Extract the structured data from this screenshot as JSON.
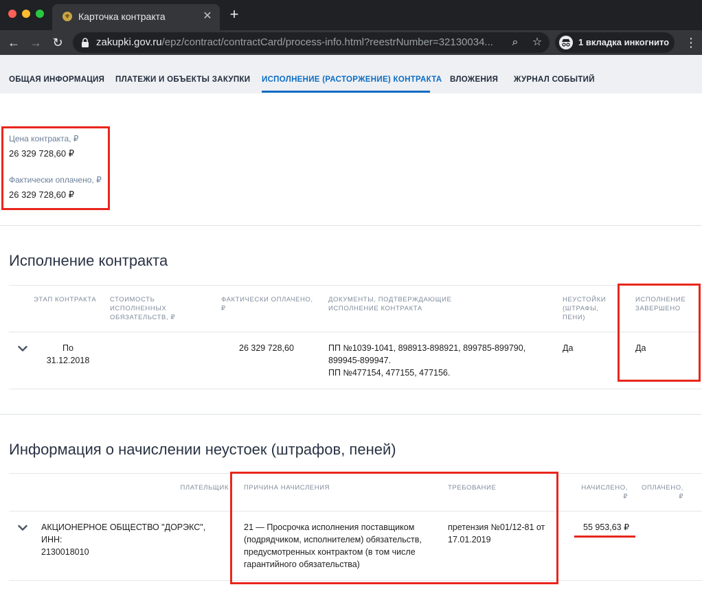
{
  "browser": {
    "tab_title": "Карточка контракта",
    "url_host": "zakupki.gov.ru",
    "url_path": "/epz/contract/contractCard/process-info.html?reestrNumber=32130034...",
    "incognito_label": "1 вкладка инкогнито"
  },
  "page_tabs": [
    {
      "label": "ОБЩАЯ ИНФОРМАЦИЯ"
    },
    {
      "label": "ПЛАТЕЖИ И ОБЪЕКТЫ ЗАКУПКИ"
    },
    {
      "label": "ИСПОЛНЕНИЕ (РАСТОРЖЕНИЕ) КОНТРАКТА"
    },
    {
      "label": "ВЛОЖЕНИЯ"
    },
    {
      "label": "ЖУРНАЛ СОБЫТИЙ"
    }
  ],
  "active_tab": "ИСПОЛНЕНИЕ (РАСТОРЖЕНИЕ) КОНТРАКТА",
  "summary": {
    "price_label": "Цена контракта, ₽",
    "price_value": "26 329 728,60 ₽",
    "paid_label": "Фактически оплачено, ₽",
    "paid_value": "26 329 728,60 ₽"
  },
  "execution": {
    "title": "Исполнение контракта",
    "headers": {
      "stage": "ЭТАП КОНТРАКТА",
      "cost": "СТОИМОСТЬ ИСПОЛНЕННЫХ ОБЯЗАТЕЛЬСТВ, ₽",
      "paid": "ФАКТИЧЕСКИ ОПЛАЧЕНО, ₽",
      "docs": "ДОКУМЕНТЫ, ПОДТВЕРЖДАЮЩИЕ ИСПОЛНЕНИЕ КОНТРАКТА",
      "penalties": "НЕУСТОЙКИ (ШТРАФЫ, ПЕНИ)",
      "completed": "ИСПОЛНЕНИЕ ЗАВЕРШЕНО"
    },
    "row": {
      "stage_line1": "По",
      "stage_line2": "31.12.2018",
      "paid": "26 329 728,60",
      "docs_line1": "ПП №1039-1041, 898913-898921, 899785-899790,",
      "docs_line2": "899945-899947.",
      "docs_line3": "ПП №477154, 477155, 477156.",
      "penalties": "Да",
      "completed": "Да"
    }
  },
  "penalties": {
    "title": "Информация о начислении неустоек (штрафов, пеней)",
    "headers": {
      "payer": "ПЛАТЕЛЬЩИК",
      "reason": "ПРИЧИНА НАЧИСЛЕНИЯ",
      "claim": "ТРЕБОВАНИЕ",
      "accrued_l1": "НАЧИСЛЕНО,",
      "accrued_l2": "₽",
      "paid_l1": "ОПЛАЧЕНО,",
      "paid_l2": "₽"
    },
    "row": {
      "payer_line1": "АКЦИОНЕРНОЕ ОБЩЕСТВО \"ДОРЭКС\", ИНН:",
      "payer_line2": "2130018010",
      "reason_line1": "21 — Просрочка исполнения поставщиком",
      "reason_line2": "(подрядчиком, исполнителем) обязательств,",
      "reason_line3": "предусмотренных контрактом (в том числе",
      "reason_line4": "гарантийного обязательства)",
      "claim_line1": "претензия №01/12-81 от",
      "claim_line2": "17.01.2019",
      "accrued": "55 953,63 ₽"
    }
  },
  "colors": {
    "accent": "#0b6cc4",
    "highlight": "#e8261c"
  }
}
